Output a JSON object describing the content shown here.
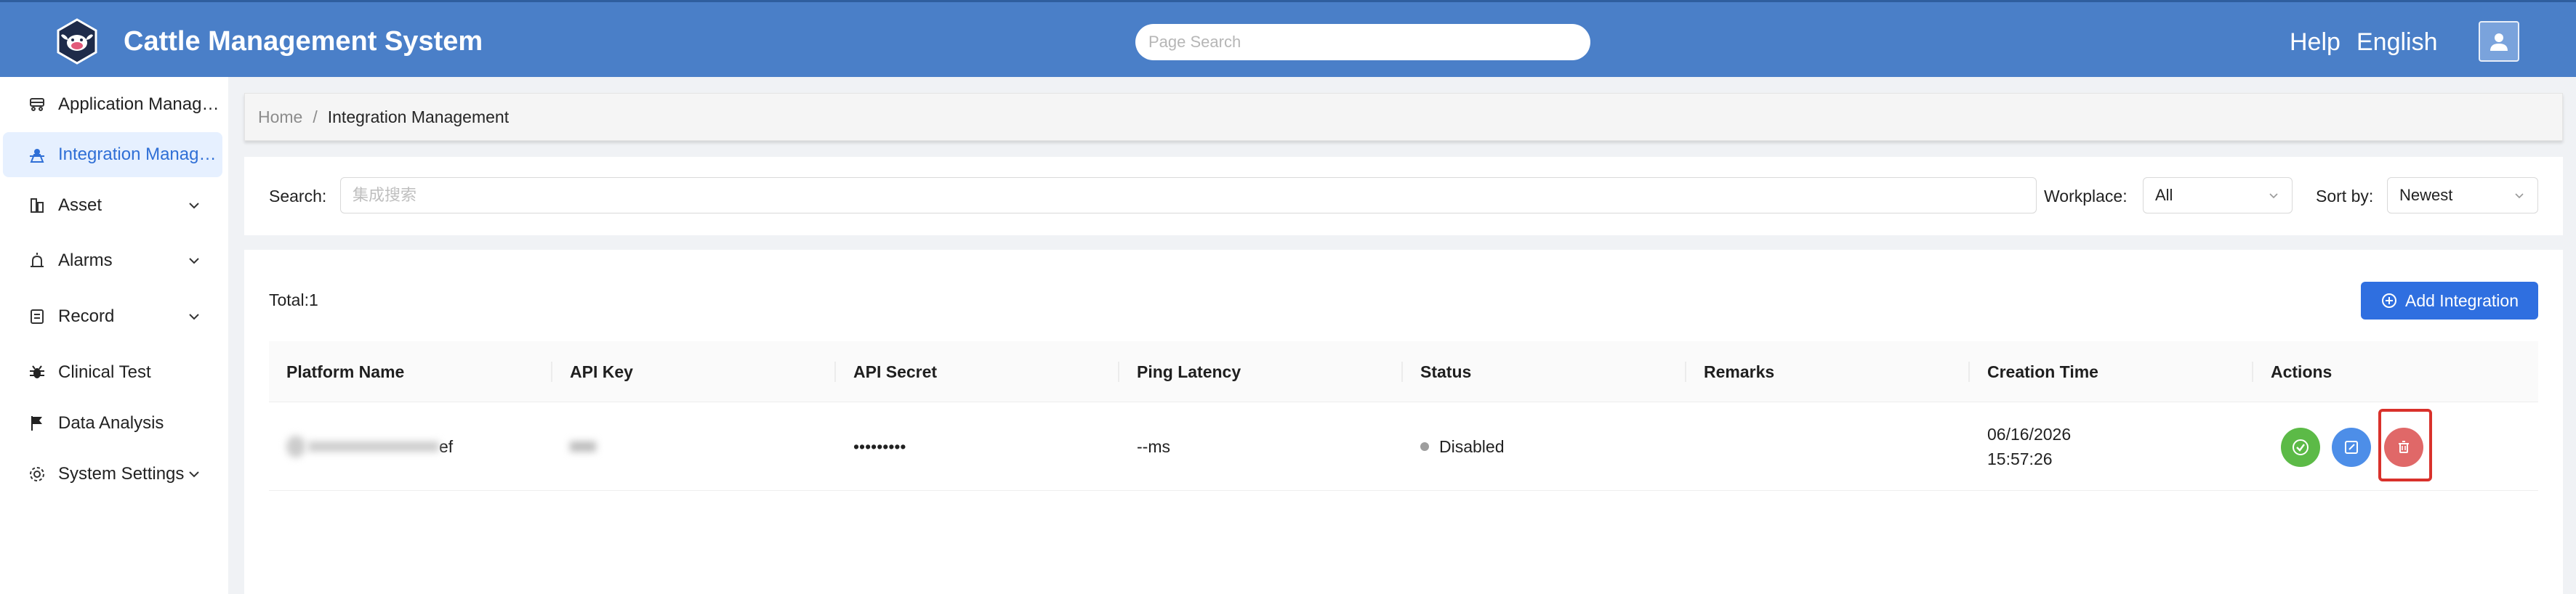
{
  "header": {
    "title": "Cattle Management System",
    "search_placeholder": "Page Search",
    "help": "Help",
    "language": "English",
    "logo_icon": "cattle-logo-icon",
    "avatar_icon": "user-icon"
  },
  "sidebar": {
    "items": [
      {
        "label": "Application Management",
        "icon": "app-icon",
        "active": false,
        "chevron": false
      },
      {
        "label": "Integration Management",
        "icon": "integration-icon",
        "active": true,
        "chevron": false
      },
      {
        "label": "Asset",
        "icon": "asset-icon",
        "active": false,
        "chevron": true
      },
      {
        "label": "Alarms",
        "icon": "alarm-icon",
        "active": false,
        "chevron": true
      },
      {
        "label": "Record",
        "icon": "record-icon",
        "active": false,
        "chevron": true
      },
      {
        "label": "Clinical Test",
        "icon": "bug-icon",
        "active": false,
        "chevron": false
      },
      {
        "label": "Data Analysis",
        "icon": "flag-icon",
        "active": false,
        "chevron": false
      },
      {
        "label": "System Settings",
        "icon": "gear-icon",
        "active": false,
        "chevron": true
      }
    ]
  },
  "breadcrumb": {
    "home": "Home",
    "separator": "/",
    "current": "Integration Management"
  },
  "filters": {
    "search_label": "Search:",
    "search_placeholder": "集成搜索",
    "workplace_label": "Workplace:",
    "workplace_value": "All",
    "sort_label": "Sort by:",
    "sort_value": "Newest"
  },
  "table": {
    "total": "Total:1",
    "add_button": "Add Integration",
    "columns": [
      "Platform Name",
      "API Key",
      "API Secret",
      "Ping Latency",
      "Status",
      "Remarks",
      "Creation Time",
      "Actions"
    ],
    "rows": [
      {
        "platform_name": "ef",
        "api_key": "",
        "api_secret": "•••••••••",
        "ping_latency": "--ms",
        "status": "Disabled",
        "remarks": "",
        "creation_date": "06/16/2026",
        "creation_time": "15:57:26"
      }
    ]
  },
  "colors": {
    "header_bg": "#4a7fc8",
    "active_bg": "#e6f0ff",
    "active_text": "#2f6fd6",
    "primary": "#2f6fe0",
    "approve": "#5cba47",
    "edit": "#4d8ee8",
    "delete": "#e06868",
    "highlight": "#d9312b"
  }
}
